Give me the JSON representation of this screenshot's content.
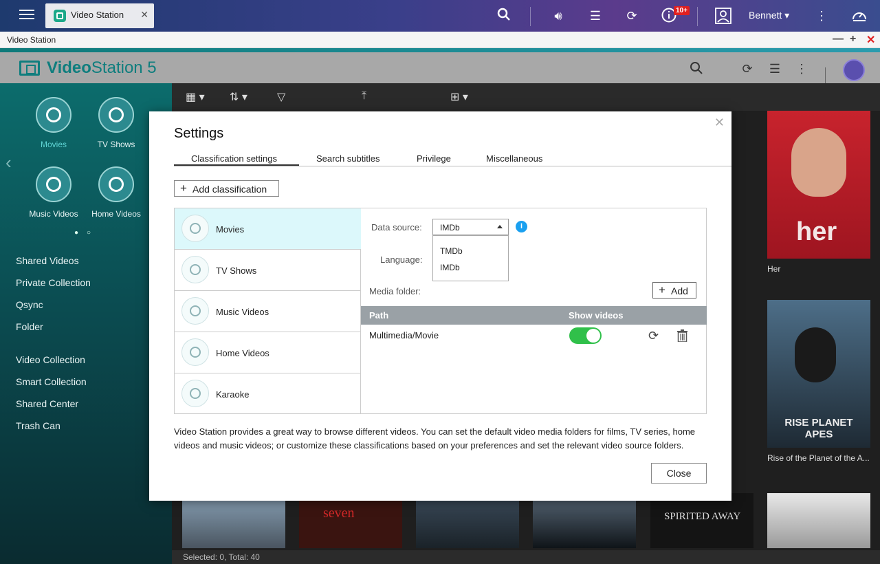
{
  "os": {
    "tab_label": "Video Station",
    "notification_badge": "10+",
    "user_name": "Bennett",
    "icons": [
      "menu-icon",
      "search-icon",
      "volume-icon",
      "stack-icon",
      "sync-icon",
      "info-icon",
      "user-icon",
      "more-icon",
      "dashboard-icon"
    ]
  },
  "window": {
    "title": "Video Station",
    "controls": [
      "—",
      "+",
      "✕"
    ]
  },
  "app": {
    "title_bold": "Video",
    "title_rest": "Station 5",
    "brand_color": "#0f7e7e"
  },
  "sidebar": {
    "categories": [
      {
        "label": "Movies",
        "active": true
      },
      {
        "label": "TV Shows",
        "active": false
      },
      {
        "label": "Music Videos",
        "active": false
      },
      {
        "label": "Home Videos",
        "active": false
      }
    ],
    "links": [
      "Shared Videos",
      "Private Collection",
      "Qsync",
      "Folder",
      "Video Collection",
      "Smart Collection",
      "Shared Center",
      "Trash Can"
    ]
  },
  "content": {
    "posters": [
      {
        "caption": "Her",
        "art": "her"
      },
      {
        "caption": "Rise of the Planet of the A...",
        "art": "RISE PLANET APES"
      },
      {
        "caption": "",
        "art": "seven"
      },
      {
        "caption": "",
        "art": "SPIRITED AWAY"
      }
    ],
    "status": "Selected: 0, Total: 40"
  },
  "dialog": {
    "title": "Settings",
    "tabs": [
      "Classification settings",
      "Search subtitles",
      "Privilege",
      "Miscellaneous"
    ],
    "add_classification": "Add classification",
    "classifications": [
      "Movies",
      "TV Shows",
      "Music Videos",
      "Home Videos",
      "Karaoke"
    ],
    "data_source_label": "Data source:",
    "data_source_value": "IMDb",
    "data_source_options": [
      "TMDb",
      "IMDb"
    ],
    "language_label": "Language:",
    "media_folder_label": "Media folder:",
    "add_label": "Add",
    "path_header": "Path",
    "show_videos_header": "Show videos",
    "path_value": "Multimedia/Movie",
    "show_videos_on": true,
    "description": "Video Station provides a great way to browse different videos. You can set the default video media folders for films, TV series, home videos and music videos; or customize these classifications based on your preferences and set the relevant video source folders.",
    "close_label": "Close",
    "toggle_color": "#30c04a",
    "info_color": "#1aa0f0"
  }
}
